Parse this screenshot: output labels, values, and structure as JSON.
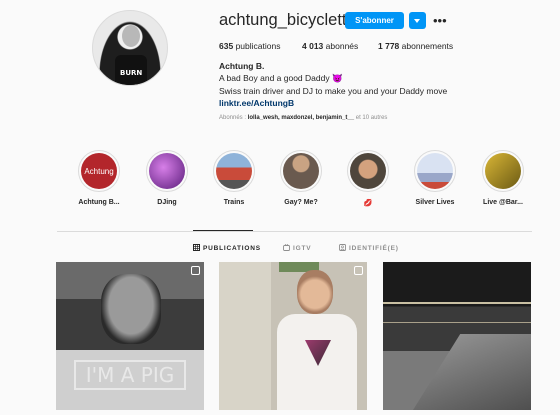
{
  "profile": {
    "username": "achtung_bicyclette",
    "follow_label": "S'abonner",
    "more_label": "•••",
    "stats": {
      "posts_count": "635",
      "posts_label": "publications",
      "followers_count": "4 013",
      "followers_label": "abonnés",
      "following_count": "1 778",
      "following_label": "abonnements"
    },
    "full_name": "Achtung B.",
    "bio_line1": "A bad Boy and a good Daddy 😈",
    "bio_line2": "Swiss train driver and DJ to make you and your Daddy move",
    "link": "linktr.ee/AchtungB",
    "followed_by_prefix": "Abonnés : ",
    "followed_by_names": "lolla_wesh, maxdonzel, benjamin_t__",
    "followed_by_suffix": " et 10 autres"
  },
  "highlights": [
    {
      "label": "Achtung B...",
      "cover_text": "Achtung",
      "color": "#b3262b"
    },
    {
      "label": "DJing",
      "color": "#7b2fa3"
    },
    {
      "label": "Trains",
      "color": "#c94b3a"
    },
    {
      "label": "Gay? Me?",
      "color": "#6a5a4f"
    },
    {
      "label": "💋",
      "color": "#8a7a6a"
    },
    {
      "label": "Silver Lives",
      "color": "#9aa7c9"
    },
    {
      "label": "Live @Bar...",
      "color": "#a38220"
    }
  ],
  "tabs": [
    {
      "label": "PUBLICATIONS",
      "active": true
    },
    {
      "label": "IGTV",
      "active": false
    },
    {
      "label": "IDENTIFIÉ(E)",
      "active": false
    }
  ],
  "posts": [
    {
      "overlay_text": "I'M A PIG",
      "type": "carousel"
    },
    {
      "type": "carousel"
    },
    {
      "type": "image"
    }
  ]
}
